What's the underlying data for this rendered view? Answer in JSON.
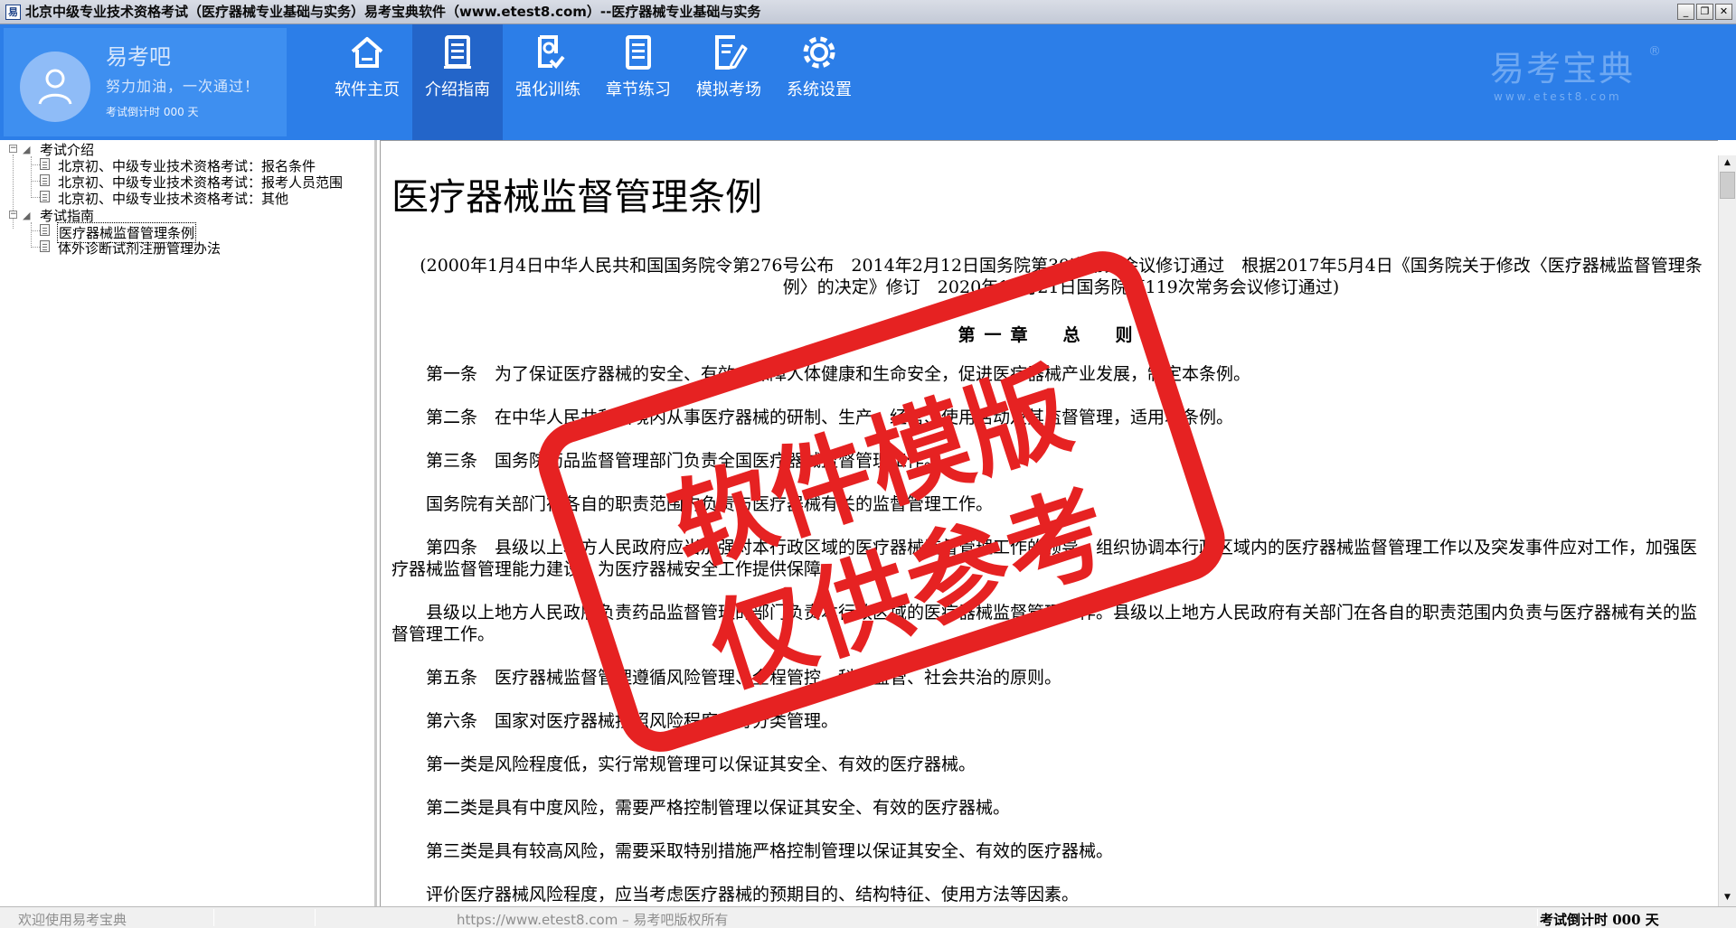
{
  "window": {
    "title": "北京中级专业技术资格考试（医疗器械专业基础与实务）易考宝典软件（www.etest8.com）--医疗器械专业基础与实务",
    "app_icon": "易",
    "minimize_label": "_",
    "maximize_label": "❐",
    "close_label": "✕"
  },
  "user": {
    "name": "易考吧",
    "slogan": "努力加油，一次通过！",
    "countdown": "考试倒计时 000 天"
  },
  "nav": {
    "items": [
      {
        "label": "软件主页",
        "icon": "home-icon"
      },
      {
        "label": "介绍指南",
        "icon": "document-icon",
        "active": true
      },
      {
        "label": "强化训练",
        "icon": "exercise-icon"
      },
      {
        "label": "章节练习",
        "icon": "list-icon"
      },
      {
        "label": "模拟考场",
        "icon": "exam-edit-icon"
      },
      {
        "label": "系统设置",
        "icon": "gear-icon"
      }
    ]
  },
  "logo": {
    "main": "易考宝典",
    "reg": "®",
    "sub": "www.etest8.com"
  },
  "tree": {
    "groups": [
      {
        "label": "考试介绍",
        "children": [
          "北京初、中级专业技术资格考试：报名条件",
          "北京初、中级专业技术资格考试：报考人员范围",
          "北京初、中级专业技术资格考试：其他"
        ]
      },
      {
        "label": "考试指南",
        "children": [
          "医疗器械监督管理条例",
          "体外诊断试剂注册管理办法"
        ]
      }
    ],
    "selected": "医疗器械监督管理条例"
  },
  "document": {
    "title": "医疗器械监督管理条例",
    "subtitle": "(2000年1月4日中华人民共和国国务院令第276号公布　2014年2月12日国务院第39次常务会议修订通过　根据2017年5月4日《国务院关于修改〈医疗器械监督管理条例〉的决定》修订　2020年12月21日国务院第119次常务会议修订通过)",
    "chapter": "第一章　总　则",
    "paragraphs": [
      "第一条　为了保证医疗器械的安全、有效，保障人体健康和生命安全，促进医疗器械产业发展，制定本条例。",
      "第二条　在中华人民共和国境内从事医疗器械的研制、生产、经营、使用活动及其监督管理，适用本条例。",
      "第三条　国务院药品监督管理部门负责全国医疗器械监督管理工作。",
      "国务院有关部门在各自的职责范围内负责与医疗器械有关的监督管理工作。",
      "第四条　县级以上地方人民政府应当加强对本行政区域的医疗器械监督管理工作的领导，组织协调本行政区域内的医疗器械监督管理工作以及突发事件应对工作，加强医疗器械监督管理能力建设，为医疗器械安全工作提供保障。",
      "县级以上地方人民政府负责药品监督管理的部门负责本行政区域的医疗器械监督管理工作。县级以上地方人民政府有关部门在各自的职责范围内负责与医疗器械有关的监督管理工作。",
      "第五条　医疗器械监督管理遵循风险管理、全程管控、科学监管、社会共治的原则。",
      "第六条　国家对医疗器械按照风险程度实行分类管理。",
      "第一类是风险程度低，实行常规管理可以保证其安全、有效的医疗器械。",
      "第二类是具有中度风险，需要严格控制管理以保证其安全、有效的医疗器械。",
      "第三类是具有较高风险，需要采取特别措施严格控制管理以保证其安全、有效的医疗器械。",
      "评价医疗器械风险程度，应当考虑医疗器械的预期目的、结构特征、使用方法等因素。"
    ]
  },
  "stamp": {
    "line1": "软件模版",
    "line2": "仅供参考",
    "color": "#e62222"
  },
  "status": {
    "left": "欢迎使用易考宝典",
    "center": "https://www.etest8.com – 易考吧版权所有",
    "right": "考试倒计时 000 天"
  },
  "colors": {
    "header_bg": "#2c7ee8",
    "nav_active_bg": "#2365c9"
  }
}
